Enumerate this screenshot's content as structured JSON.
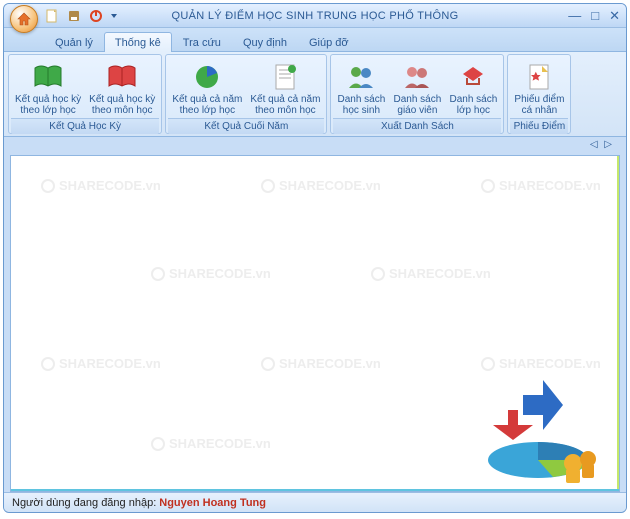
{
  "window": {
    "title": "QUẢN LÝ ĐIỂM HỌC SINH TRUNG HỌC PHỔ THÔNG"
  },
  "tabs": {
    "t0": "Quản lý",
    "t1": "Thống kê",
    "t2": "Tra cứu",
    "t3": "Quy định",
    "t4": "Giúp đỡ"
  },
  "ribbon": {
    "g0": {
      "title": "Kết Quả Học Kỳ",
      "b0": "Kết quả học kỳ\ntheo lớp học",
      "b1": "Kết quả học kỳ\ntheo môn học"
    },
    "g1": {
      "title": "Kết Quả Cuối Năm",
      "b0": "Kết quả cả năm\ntheo lớp học",
      "b1": "Kết quả cả năm\ntheo môn học"
    },
    "g2": {
      "title": "Xuất Danh Sách",
      "b0": "Danh sách\nhọc sinh",
      "b1": "Danh sách\ngiáo viên",
      "b2": "Danh sách\nlớp học"
    },
    "g3": {
      "title": "Phiếu Điểm",
      "b0": "Phiếu điểm\ncá nhân"
    }
  },
  "watermark": "SHARECODE.vn",
  "status": {
    "label": "Người dùng đang đăng nhập:",
    "user": "Nguyen Hoang Tung"
  }
}
